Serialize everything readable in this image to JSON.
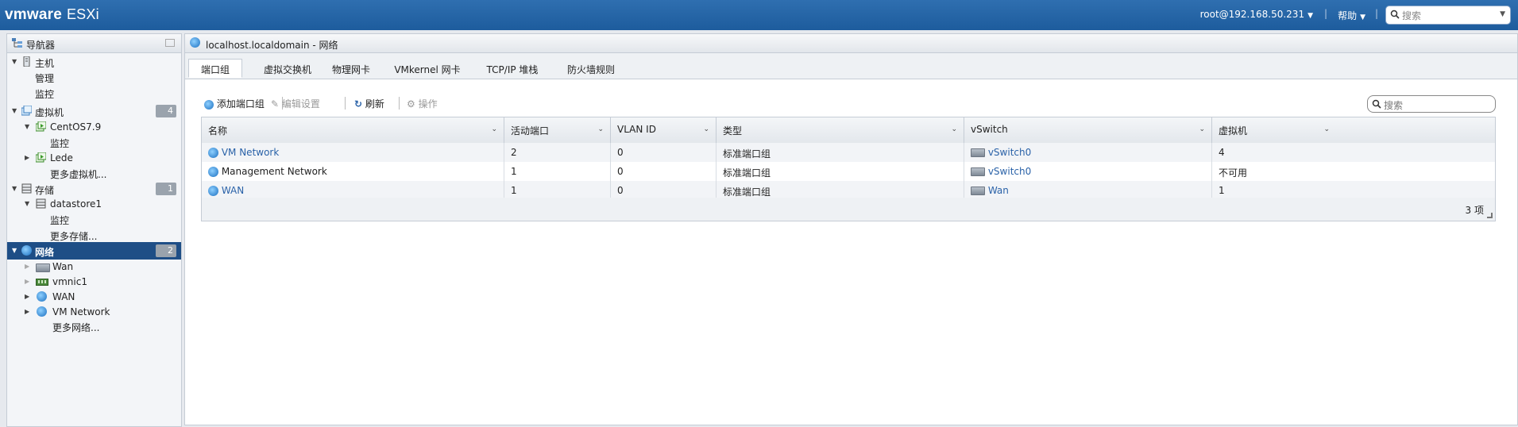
{
  "topbar": {
    "logo_vm": "vmware",
    "logo_esxi": "ESXi",
    "user": "root@192.168.50.231",
    "help": "帮助",
    "search_placeholder": "搜索",
    "bg_color": "#1d5c9d"
  },
  "navigator": {
    "title": "导航器",
    "items": [
      {
        "label": "主机"
      },
      {
        "label": "管理"
      },
      {
        "label": "监控"
      },
      {
        "label": "虚拟机",
        "badge": "4"
      },
      {
        "label": "CentOS7.9"
      },
      {
        "label": "监控"
      },
      {
        "label": "Lede"
      },
      {
        "label": "更多虚拟机..."
      },
      {
        "label": "存储",
        "badge": "1"
      },
      {
        "label": "datastore1"
      },
      {
        "label": "监控"
      },
      {
        "label": "更多存储..."
      },
      {
        "label": "网络",
        "badge": "2"
      },
      {
        "label": "Wan"
      },
      {
        "label": "vmnic1"
      },
      {
        "label": "WAN"
      },
      {
        "label": "VM Network"
      },
      {
        "label": "更多网络..."
      }
    ],
    "selected_color": "#1e4e86"
  },
  "main": {
    "title": "localhost.localdomain - 网络",
    "tabs": [
      {
        "label": "端口组"
      },
      {
        "label": "虚拟交换机"
      },
      {
        "label": "物理网卡"
      },
      {
        "label": "VMkernel 网卡"
      },
      {
        "label": "TCP/IP 堆栈"
      },
      {
        "label": "防火墙规则"
      }
    ],
    "toolbar": {
      "add": "添加端口组",
      "edit": "编辑设置",
      "refresh": "刷新",
      "actions": "操作",
      "search_placeholder": "搜索"
    },
    "table": {
      "columns": [
        "名称",
        "活动端口",
        "VLAN ID",
        "类型",
        "vSwitch",
        "虚拟机"
      ],
      "rows": [
        {
          "name": "VM Network",
          "active_ports": "2",
          "vlan": "0",
          "type": "标准端口组",
          "vswitch": "vSwitch0",
          "vms": "4"
        },
        {
          "name": "Management Network",
          "active_ports": "1",
          "vlan": "0",
          "type": "标准端口组",
          "vswitch": "vSwitch0",
          "vms": "不可用"
        },
        {
          "name": "WAN",
          "active_ports": "1",
          "vlan": "0",
          "type": "标准端口组",
          "vswitch": "Wan",
          "vms": "1"
        }
      ],
      "count": "3 项"
    },
    "link_color": "#2a62a8"
  }
}
